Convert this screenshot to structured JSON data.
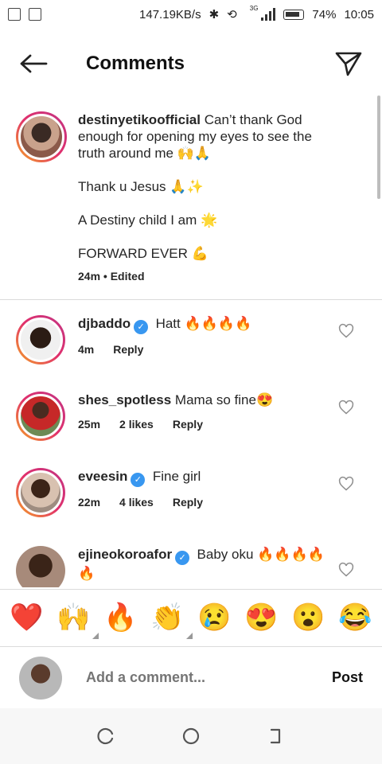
{
  "status_bar": {
    "speed": "147.19KB/s",
    "network": "3G",
    "battery": "74%",
    "time": "10:05"
  },
  "header": {
    "title": "Comments",
    "back_icon": "arrow-left-icon",
    "send_icon": "paper-plane-icon"
  },
  "caption": {
    "username": "destinyetikoofficial",
    "text_1": "Can’t thank God enough for opening my eyes to see the truth around me 🙌🙏",
    "text_2": "Thank u Jesus 🙏✨",
    "text_3": "A Destiny child I am 🌟",
    "text_4": "FORWARD EVER 💪",
    "time": "24m",
    "edited": "Edited"
  },
  "comments": [
    {
      "username": "djbaddo",
      "verified": true,
      "text": "Hatt 🔥🔥🔥🔥",
      "time": "4m",
      "likes": "",
      "reply": "Reply"
    },
    {
      "username": "shes_spotless",
      "verified": false,
      "text": "Mama so fine😍",
      "time": "25m",
      "likes": "2 likes",
      "reply": "Reply"
    },
    {
      "username": "eveesin",
      "verified": true,
      "text": "Fine girl",
      "time": "22m",
      "likes": "4 likes",
      "reply": "Reply"
    },
    {
      "username": "ejineokoroafor",
      "verified": true,
      "text": "Baby oku 🔥🔥🔥🔥🔥",
      "time": "",
      "likes": "",
      "reply": ""
    }
  ],
  "emoji_bar": [
    "❤️",
    "🙌",
    "🔥",
    "👏",
    "😢",
    "😍",
    "😮",
    "😂"
  ],
  "input": {
    "placeholder": "Add a comment...",
    "post_label": "Post"
  },
  "colors": {
    "verified": "#3897f0",
    "ring_start": "#f5a623",
    "ring_end": "#c13584",
    "divider": "#dbdbdb"
  }
}
